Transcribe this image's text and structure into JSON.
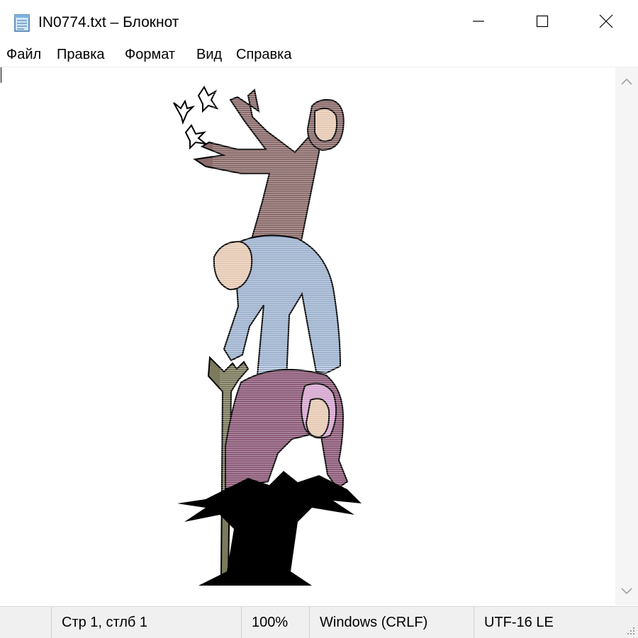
{
  "window": {
    "title": "IN0774.txt – Блокнот"
  },
  "menu": {
    "items": [
      "Файл",
      "Правка",
      "Формат",
      "Вид",
      "Справка"
    ]
  },
  "status": {
    "position": "Стр 1, стлб 1",
    "zoom": "100%",
    "line_endings": "Windows (CRLF)",
    "encoding": "UTF-16 LE"
  },
  "colors": {
    "figure_top": "#8b6b6b",
    "figure_middle": "#9fb3cf",
    "figure_bottom": "#8c5a78",
    "face": "#e6c9b4",
    "hood_pink": "#d6a6cf",
    "stick": "#7c7a5c",
    "palm": "#000000"
  },
  "icons": {
    "app": "notepad-icon",
    "minimize": "minimize-icon",
    "maximize": "maximize-icon",
    "close": "close-icon",
    "scroll_up": "chevron-up-icon",
    "scroll_down": "chevron-down-icon",
    "grip": "resize-grip-icon"
  }
}
